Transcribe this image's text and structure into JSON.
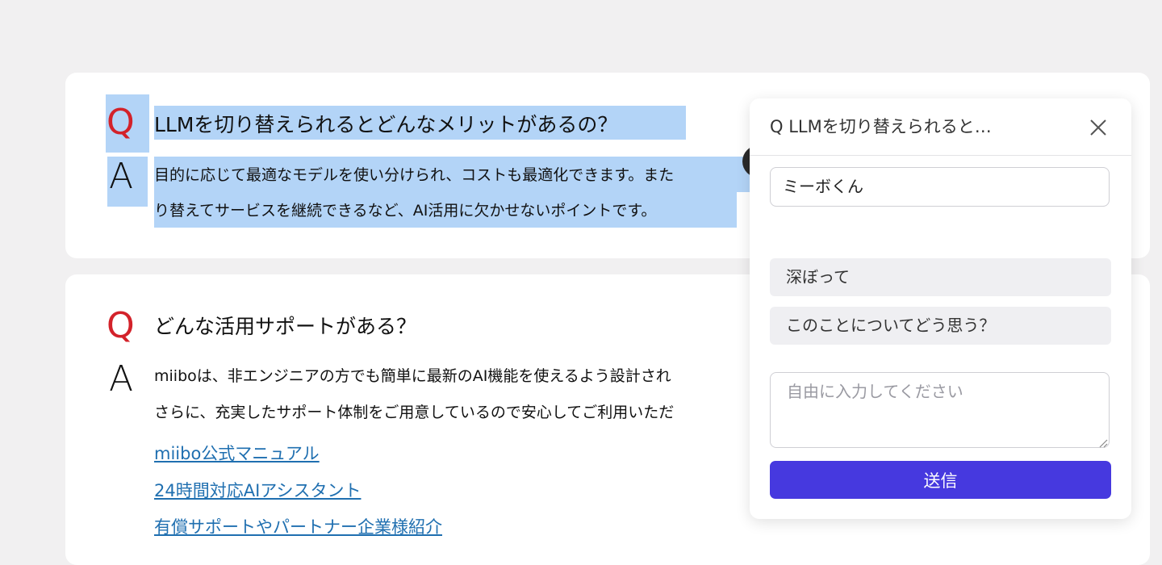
{
  "faq": [
    {
      "q_mark": "Q",
      "a_mark": "A",
      "question": "LLMを切り替えられるとどんなメリットがあるの？",
      "answer_lines": [
        "目的に応じて最適なモデルを使い分けられ、コストも最適化できます。また",
        "り替えてサービスを継続できるなど、AI活用に欠かせないポイントです。"
      ]
    },
    {
      "q_mark": "Q",
      "a_mark": "A",
      "question": "どんな活用サポートがある？",
      "answer_lines": [
        "miiboは、非エンジニアの方でも簡単に最新のAI機能を使えるよう設計され",
        "さらに、充実したサポート体制をご用意しているので安心してご利用いただ"
      ],
      "links": [
        "miibo公式マニュアル",
        "24時間対応AIアシスタント",
        "有償サポートやパートナー企業様紹介"
      ]
    }
  ],
  "panel": {
    "title": "Q LLMを切り替えられると…",
    "close_icon": "close-icon",
    "agent_name_value": "ミーボくん",
    "suggestions": [
      "深ぼって",
      "このことについてどう思う？"
    ],
    "input_placeholder": "自由に入力してください",
    "send_label": "送信"
  },
  "colors": {
    "q_mark": "#d3222a",
    "selection": "#b3d4f7",
    "link": "#1f6fb0",
    "send_button": "#4639df",
    "background": "#f1f0f1"
  }
}
